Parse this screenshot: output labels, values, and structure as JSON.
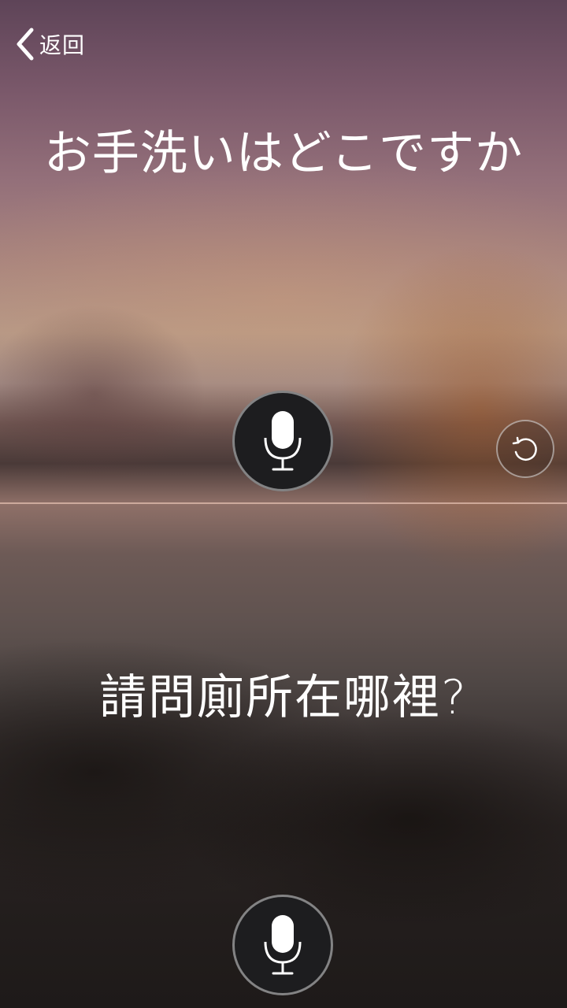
{
  "header": {
    "back_label": "返回",
    "back_icon": "chevron-left-icon"
  },
  "source": {
    "text": "お手洗いはどこですか",
    "mic_icon": "microphone-icon"
  },
  "target": {
    "text": "請問廁所在哪裡?",
    "mic_icon": "microphone-icon"
  },
  "controls": {
    "reset_icon": "rotate-ccw-icon"
  },
  "colors": {
    "text": "#ffffff",
    "mic_button_bg": "#1d1d1f",
    "divider": "#e1beaf"
  }
}
